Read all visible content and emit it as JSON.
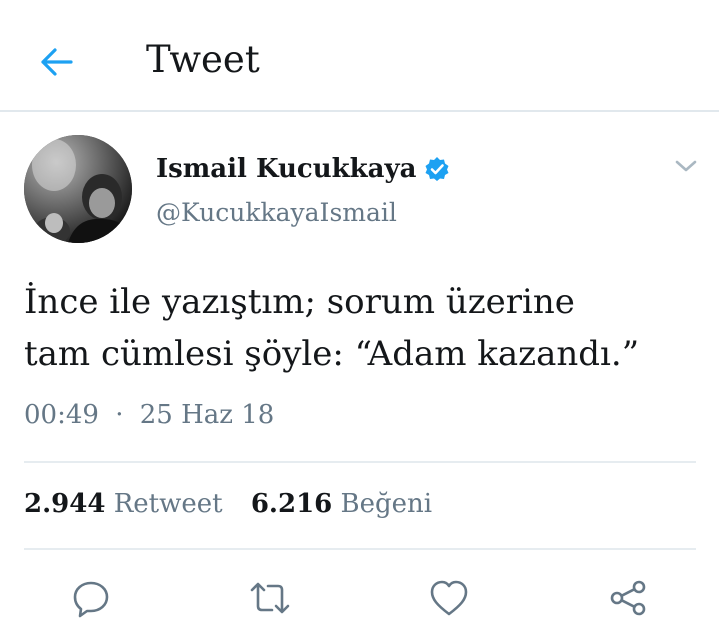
{
  "header": {
    "title": "Tweet",
    "back_icon": "arrow-left-icon",
    "accent": "#1da1f2"
  },
  "author": {
    "name": "Ismail Kucukkaya",
    "handle": "@KucukkayaIsmail",
    "verified_icon": "verified-badge-icon",
    "avatar_icon": "avatar-photo",
    "menu_icon": "chevron-down-icon"
  },
  "tweet": {
    "lines": [
      "İnce ile yazıştım; sorum üzerine",
      "tam cümlesi şöyle: “Adam kazandı.”"
    ],
    "time": "00:49",
    "separator": "·",
    "date": "25 Haz 18"
  },
  "stats": {
    "retweet_count": "2.944",
    "retweet_label": "Retweet",
    "like_count": "6.216",
    "like_label": "Beğeni"
  },
  "actions": [
    {
      "icon": "reply-icon"
    },
    {
      "icon": "retweet-icon"
    },
    {
      "icon": "like-heart-icon"
    },
    {
      "icon": "share-icon"
    }
  ],
  "colors": {
    "text": "#14171a",
    "secondary": "#657786",
    "icon": "#657786",
    "divider": "#e6ecf0"
  }
}
